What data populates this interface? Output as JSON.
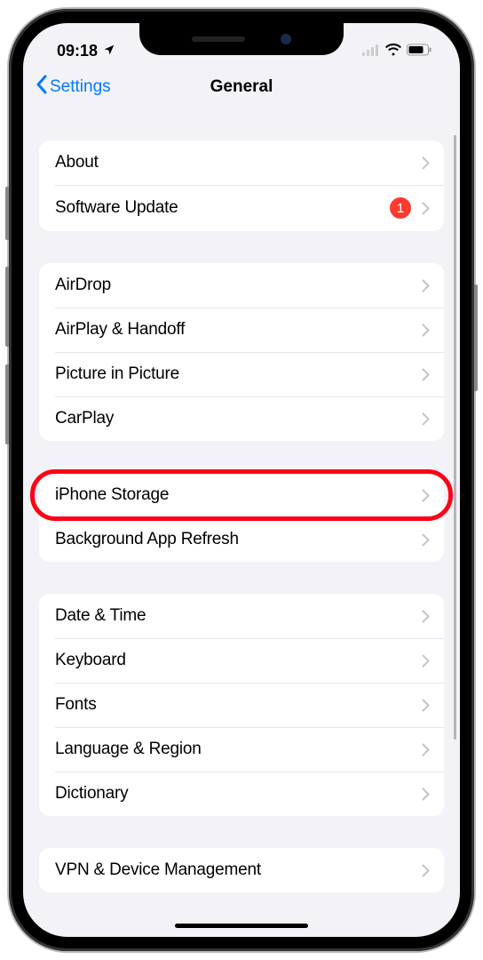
{
  "status": {
    "time": "09:18"
  },
  "nav": {
    "back": "Settings",
    "title": "General"
  },
  "groups": [
    {
      "rows": [
        {
          "label": "About",
          "name": "row-about"
        },
        {
          "label": "Software Update",
          "name": "row-software-update",
          "badge": "1"
        }
      ]
    },
    {
      "rows": [
        {
          "label": "AirDrop",
          "name": "row-airdrop"
        },
        {
          "label": "AirPlay & Handoff",
          "name": "row-airplay-handoff"
        },
        {
          "label": "Picture in Picture",
          "name": "row-picture-in-picture"
        },
        {
          "label": "CarPlay",
          "name": "row-carplay"
        }
      ]
    },
    {
      "rows": [
        {
          "label": "iPhone Storage",
          "name": "row-iphone-storage",
          "highlighted": true
        },
        {
          "label": "Background App Refresh",
          "name": "row-background-app-refresh"
        }
      ]
    },
    {
      "rows": [
        {
          "label": "Date & Time",
          "name": "row-date-time"
        },
        {
          "label": "Keyboard",
          "name": "row-keyboard"
        },
        {
          "label": "Fonts",
          "name": "row-fonts"
        },
        {
          "label": "Language & Region",
          "name": "row-language-region"
        },
        {
          "label": "Dictionary",
          "name": "row-dictionary"
        }
      ]
    },
    {
      "rows": [
        {
          "label": "VPN & Device Management",
          "name": "row-vpn-device-management"
        }
      ]
    }
  ]
}
